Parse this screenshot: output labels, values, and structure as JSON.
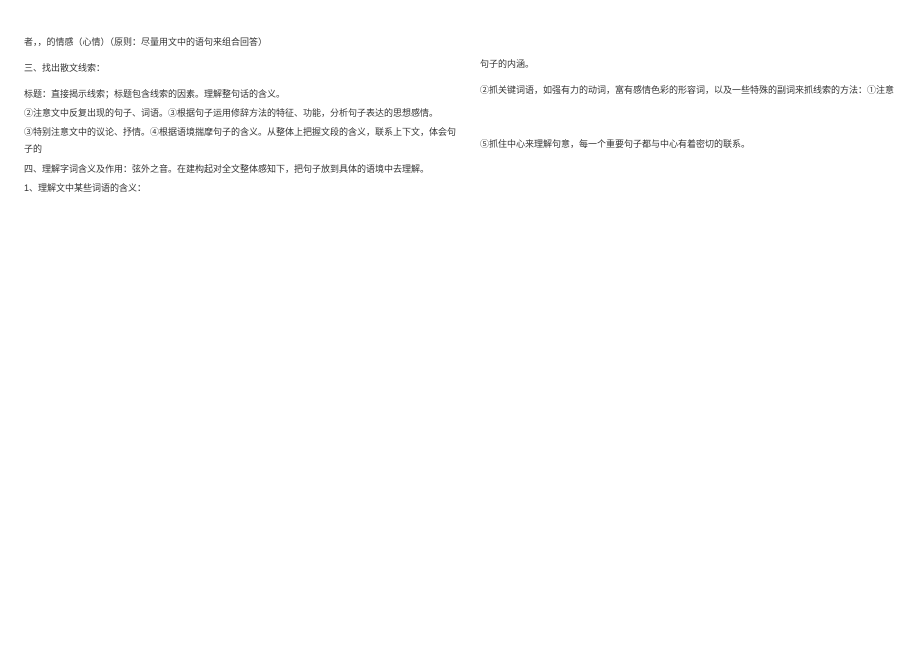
{
  "left": {
    "l1": "者，，的情感（心情）（原则：尽量用文中的语句来组合回答）",
    "l2": "三、找出散文线索：",
    "l3": "标题：直接揭示线索；标题包含线索的因素。理解整句话的含义。",
    "l4": "②注意文中反复出现的句子、词语。③根据句子运用修辞方法的特征、功能，分析句子表达的思想感情。",
    "l5": "③特别注意文中的议论、抒情。④根据语境揣摩句子的含义。从整体上把握文段的含义，联系上下文，体会句子的",
    "l6": "四、理解字词含义及作用：弦外之音。在建构起对全文整体感知下，把句子放到具体的语境中去理解。",
    "l7": "1、理解文中某些词语的含义："
  },
  "right": {
    "r1": "句子的内涵。",
    "r2": "②抓关键词语，如强有力的动词，富有感情色彩的形容词，以及一些特殊的副词来抓线索的方法：①注意",
    "r3": "⑤抓住中心来理解句意，每一个重要句子都与中心有着密切的联系。"
  }
}
